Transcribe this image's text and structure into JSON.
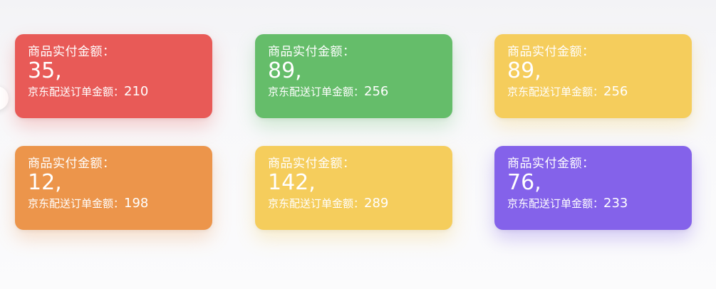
{
  "cards": [
    {
      "label": "商品实付金额：",
      "amount": "35,",
      "delivery_label": "京东配送订单金额：",
      "delivery_value": "210",
      "color": "#e85a57",
      "shadow": "rgba(232,90,87,0.28)"
    },
    {
      "label": "商品实付金额：",
      "amount": "89,",
      "delivery_label": "京东配送订单金额：",
      "delivery_value": "256",
      "color": "#65bd6a",
      "shadow": "rgba(101,189,106,0.28)"
    },
    {
      "label": "商品实付金额：",
      "amount": "89,",
      "delivery_label": "京东配送订单金额：",
      "delivery_value": "256",
      "color": "#f5cd5c",
      "shadow": "rgba(245,205,92,0.30)"
    },
    {
      "label": "商品实付金额：",
      "amount": "12,",
      "delivery_label": "京东配送订单金额：",
      "delivery_value": "198",
      "color": "#ec954b",
      "shadow": "rgba(236,149,75,0.28)"
    },
    {
      "label": "商品实付金额：",
      "amount": "142,",
      "delivery_label": "京东配送订单金额：",
      "delivery_value": "289",
      "color": "#f5cd5c",
      "shadow": "rgba(245,205,92,0.30)"
    },
    {
      "label": "商品实付金额：",
      "amount": "76,",
      "delivery_label": "京东配送订单金额：",
      "delivery_value": "233",
      "color": "#8462ea",
      "shadow": "rgba(132,98,234,0.32)"
    }
  ]
}
